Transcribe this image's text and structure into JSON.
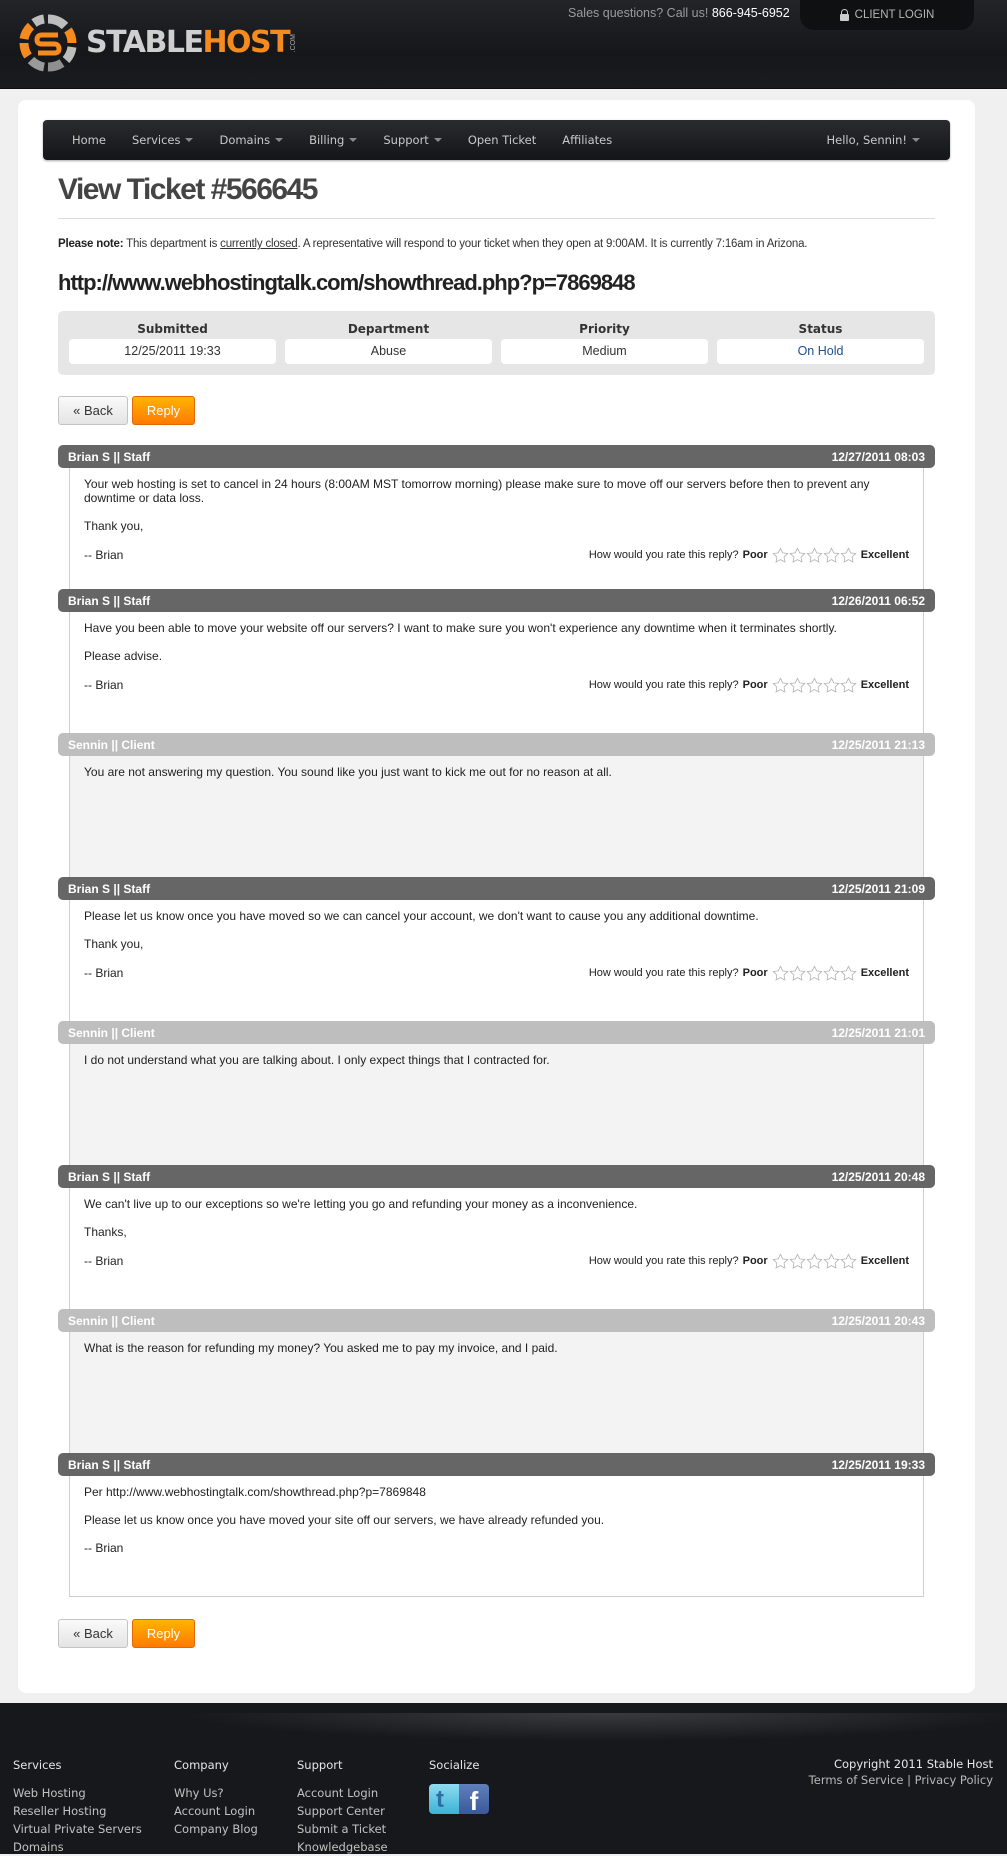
{
  "header": {
    "brand_stable": "STABLE",
    "brand_host": "HOST",
    "brand_com": ".COM",
    "sales_prefix": "Sales questions? Call us!",
    "sales_phone": "866-945-6952",
    "client_login": "CLIENT LOGIN",
    "icons": {
      "lock": "lock-icon",
      "logo": "stablehost-logo-icon"
    }
  },
  "nav": {
    "items": [
      {
        "label": "Home",
        "dropdown": false
      },
      {
        "label": "Services",
        "dropdown": true
      },
      {
        "label": "Domains",
        "dropdown": true
      },
      {
        "label": "Billing",
        "dropdown": true
      },
      {
        "label": "Support",
        "dropdown": true
      },
      {
        "label": "Open Ticket",
        "dropdown": false
      },
      {
        "label": "Affiliates",
        "dropdown": false
      }
    ],
    "user_greeting": "Hello, Sennin!"
  },
  "ticket": {
    "title": "View Ticket #566645",
    "note_label": "Please note:",
    "note_pre": "This department is",
    "note_link": "currently closed",
    "note_post": ". A representative will respond to your ticket when they open at 9:00AM. It is currently 7:16am in Arizona.",
    "subject": "http://www.webhostingtalk.com/showthread.php?p=7869848",
    "info": {
      "submitted_label": "Submitted",
      "submitted_value": "12/25/2011 19:33",
      "department_label": "Department",
      "department_value": "Abuse",
      "priority_label": "Priority",
      "priority_value": "Medium",
      "status_label": "Status",
      "status_value": "On Hold"
    },
    "status_color": "#1e4f8f"
  },
  "buttons": {
    "back": "« Back",
    "reply": "Reply"
  },
  "rating": {
    "question": "How would you rate this reply?",
    "poor": "Poor",
    "excellent": "Excellent",
    "stars": 5
  },
  "messages": [
    {
      "author": "Brian S || Staff",
      "date": "12/27/2011 08:03",
      "type": "staff",
      "lines": [
        "Your web hosting is set to cancel in 24 hours (8:00AM MST tomorrow morning) please make sure to move off our servers before then to prevent any downtime or data loss.",
        "Thank you,"
      ],
      "signature": "-- Brian",
      "rateable": true
    },
    {
      "author": "Brian S || Staff",
      "date": "12/26/2011 06:52",
      "type": "staff",
      "lines": [
        "Have you been able to move your website off our servers? I want to make sure you won't experience any downtime when it terminates shortly.",
        "Please advise."
      ],
      "signature": "-- Brian",
      "rateable": true
    },
    {
      "author": "Sennin || Client",
      "date": "12/25/2011 21:13",
      "type": "client",
      "lines": [
        "You are not answering my question. You sound like you just want to kick me out for no reason at all."
      ],
      "signature": "",
      "rateable": false
    },
    {
      "author": "Brian S || Staff",
      "date": "12/25/2011 21:09",
      "type": "staff",
      "lines": [
        "Please let us know once you have moved so we can cancel your account, we don't want to cause you any additional downtime.",
        "Thank you,"
      ],
      "signature": "-- Brian",
      "rateable": true
    },
    {
      "author": "Sennin || Client",
      "date": "12/25/2011 21:01",
      "type": "client",
      "lines": [
        "I do not understand what you are talking about. I only expect things that I contracted for."
      ],
      "signature": "",
      "rateable": false
    },
    {
      "author": "Brian S || Staff",
      "date": "12/25/2011 20:48",
      "type": "staff",
      "lines": [
        "We can't live up to our exceptions so we're letting you go and refunding your money as a inconvenience.",
        "Thanks,"
      ],
      "signature": "-- Brian",
      "rateable": true
    },
    {
      "author": "Sennin || Client",
      "date": "12/25/2011 20:43",
      "type": "client",
      "lines": [
        "What is the reason for refunding my money? You asked me to pay my invoice, and I paid."
      ],
      "signature": "",
      "rateable": false
    },
    {
      "author": "Brian S || Staff",
      "date": "12/25/2011 19:33",
      "type": "staff",
      "lines": [
        "Per http://www.webhostingtalk.com/showthread.php?p=7869848",
        "Please let us know once you have moved your site off our servers, we have already refunded you."
      ],
      "signature": "-- Brian",
      "rateable": false
    }
  ],
  "footer": {
    "columns": [
      {
        "heading": "Services",
        "links": [
          "Web Hosting",
          "Reseller Hosting",
          "Virtual Private Servers",
          "Domains"
        ]
      },
      {
        "heading": "Company",
        "links": [
          "Why Us?",
          "Account Login",
          "Company Blog"
        ]
      },
      {
        "heading": "Support",
        "links": [
          "Account Login",
          "Support Center",
          "Submit a Ticket",
          "Knowledgebase"
        ]
      }
    ],
    "socialize_heading": "Socialize",
    "social_icons": [
      "twitter-icon",
      "facebook-icon"
    ],
    "copyright": "Copyright 2011 Stable Host",
    "terms": "Terms of Service",
    "separator": "|",
    "privacy": "Privacy Policy"
  },
  "colors": {
    "accent_orange": "#ff8a00",
    "staff_header": "#666666",
    "client_header": "#bebebe",
    "header_bg": "#17181b"
  }
}
